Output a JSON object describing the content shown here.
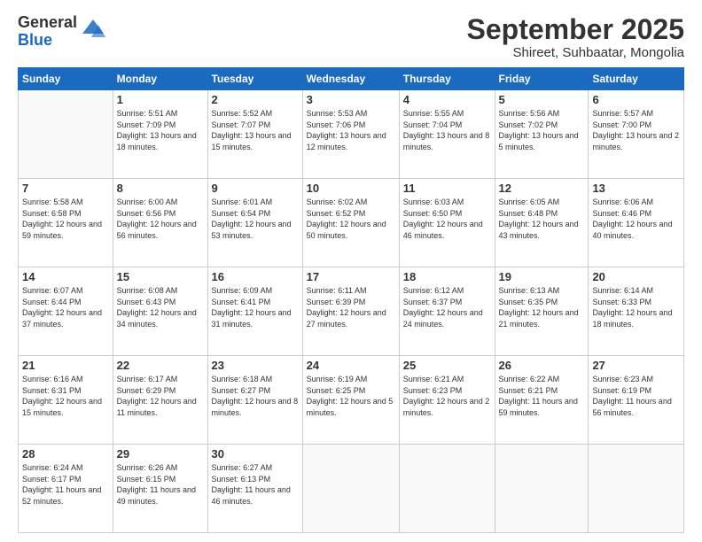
{
  "logo": {
    "general": "General",
    "blue": "Blue"
  },
  "title": "September 2025",
  "subtitle": "Shireet, Suhbaatar, Mongolia",
  "weekdays": [
    "Sunday",
    "Monday",
    "Tuesday",
    "Wednesday",
    "Thursday",
    "Friday",
    "Saturday"
  ],
  "weeks": [
    [
      {
        "day": "",
        "info": ""
      },
      {
        "day": "1",
        "info": "Sunrise: 5:51 AM\nSunset: 7:09 PM\nDaylight: 13 hours\nand 18 minutes."
      },
      {
        "day": "2",
        "info": "Sunrise: 5:52 AM\nSunset: 7:07 PM\nDaylight: 13 hours\nand 15 minutes."
      },
      {
        "day": "3",
        "info": "Sunrise: 5:53 AM\nSunset: 7:06 PM\nDaylight: 13 hours\nand 12 minutes."
      },
      {
        "day": "4",
        "info": "Sunrise: 5:55 AM\nSunset: 7:04 PM\nDaylight: 13 hours\nand 8 minutes."
      },
      {
        "day": "5",
        "info": "Sunrise: 5:56 AM\nSunset: 7:02 PM\nDaylight: 13 hours\nand 5 minutes."
      },
      {
        "day": "6",
        "info": "Sunrise: 5:57 AM\nSunset: 7:00 PM\nDaylight: 13 hours\nand 2 minutes."
      }
    ],
    [
      {
        "day": "7",
        "info": "Sunrise: 5:58 AM\nSunset: 6:58 PM\nDaylight: 12 hours\nand 59 minutes."
      },
      {
        "day": "8",
        "info": "Sunrise: 6:00 AM\nSunset: 6:56 PM\nDaylight: 12 hours\nand 56 minutes."
      },
      {
        "day": "9",
        "info": "Sunrise: 6:01 AM\nSunset: 6:54 PM\nDaylight: 12 hours\nand 53 minutes."
      },
      {
        "day": "10",
        "info": "Sunrise: 6:02 AM\nSunset: 6:52 PM\nDaylight: 12 hours\nand 50 minutes."
      },
      {
        "day": "11",
        "info": "Sunrise: 6:03 AM\nSunset: 6:50 PM\nDaylight: 12 hours\nand 46 minutes."
      },
      {
        "day": "12",
        "info": "Sunrise: 6:05 AM\nSunset: 6:48 PM\nDaylight: 12 hours\nand 43 minutes."
      },
      {
        "day": "13",
        "info": "Sunrise: 6:06 AM\nSunset: 6:46 PM\nDaylight: 12 hours\nand 40 minutes."
      }
    ],
    [
      {
        "day": "14",
        "info": "Sunrise: 6:07 AM\nSunset: 6:44 PM\nDaylight: 12 hours\nand 37 minutes."
      },
      {
        "day": "15",
        "info": "Sunrise: 6:08 AM\nSunset: 6:43 PM\nDaylight: 12 hours\nand 34 minutes."
      },
      {
        "day": "16",
        "info": "Sunrise: 6:09 AM\nSunset: 6:41 PM\nDaylight: 12 hours\nand 31 minutes."
      },
      {
        "day": "17",
        "info": "Sunrise: 6:11 AM\nSunset: 6:39 PM\nDaylight: 12 hours\nand 27 minutes."
      },
      {
        "day": "18",
        "info": "Sunrise: 6:12 AM\nSunset: 6:37 PM\nDaylight: 12 hours\nand 24 minutes."
      },
      {
        "day": "19",
        "info": "Sunrise: 6:13 AM\nSunset: 6:35 PM\nDaylight: 12 hours\nand 21 minutes."
      },
      {
        "day": "20",
        "info": "Sunrise: 6:14 AM\nSunset: 6:33 PM\nDaylight: 12 hours\nand 18 minutes."
      }
    ],
    [
      {
        "day": "21",
        "info": "Sunrise: 6:16 AM\nSunset: 6:31 PM\nDaylight: 12 hours\nand 15 minutes."
      },
      {
        "day": "22",
        "info": "Sunrise: 6:17 AM\nSunset: 6:29 PM\nDaylight: 12 hours\nand 11 minutes."
      },
      {
        "day": "23",
        "info": "Sunrise: 6:18 AM\nSunset: 6:27 PM\nDaylight: 12 hours\nand 8 minutes."
      },
      {
        "day": "24",
        "info": "Sunrise: 6:19 AM\nSunset: 6:25 PM\nDaylight: 12 hours\nand 5 minutes."
      },
      {
        "day": "25",
        "info": "Sunrise: 6:21 AM\nSunset: 6:23 PM\nDaylight: 12 hours\nand 2 minutes."
      },
      {
        "day": "26",
        "info": "Sunrise: 6:22 AM\nSunset: 6:21 PM\nDaylight: 11 hours\nand 59 minutes."
      },
      {
        "day": "27",
        "info": "Sunrise: 6:23 AM\nSunset: 6:19 PM\nDaylight: 11 hours\nand 56 minutes."
      }
    ],
    [
      {
        "day": "28",
        "info": "Sunrise: 6:24 AM\nSunset: 6:17 PM\nDaylight: 11 hours\nand 52 minutes."
      },
      {
        "day": "29",
        "info": "Sunrise: 6:26 AM\nSunset: 6:15 PM\nDaylight: 11 hours\nand 49 minutes."
      },
      {
        "day": "30",
        "info": "Sunrise: 6:27 AM\nSunset: 6:13 PM\nDaylight: 11 hours\nand 46 minutes."
      },
      {
        "day": "",
        "info": ""
      },
      {
        "day": "",
        "info": ""
      },
      {
        "day": "",
        "info": ""
      },
      {
        "day": "",
        "info": ""
      }
    ]
  ]
}
